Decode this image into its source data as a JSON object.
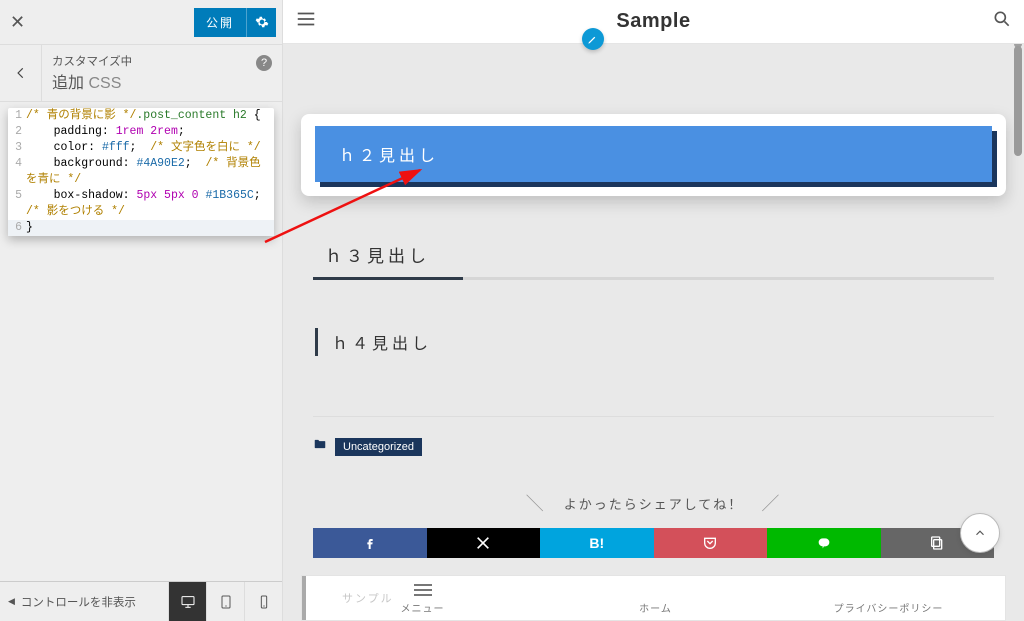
{
  "sidebar": {
    "publish_label": "公開",
    "crumb": "カスタマイズ中",
    "title_prefix": "追加",
    "title_thin": "CSS",
    "hide_controls": "コントロールを非表示"
  },
  "code": {
    "l1_comment": "/* 青の背景に影 */",
    "l1_sel": ".post_content h2",
    "l1_brace": " {",
    "l2_prop": "padding",
    "l2_val": "1rem 2rem",
    "l3_prop": "color",
    "l3_val": "#fff",
    "l3_comment": "/* 文字色を白に */",
    "l4_prop": "background",
    "l4_val": "#4A90E2",
    "l4_comment": "/* 背景色を青に */",
    "l5_prop": "box-shadow",
    "l5_val_nums": "5px 5px 0",
    "l5_val_hex": "#1B365C",
    "l5_comment": "/* 影をつける */",
    "l6": "}"
  },
  "preview": {
    "site_title": "Sample",
    "h2": "ｈ２見出し",
    "h3": "ｈ３見出し",
    "h4": "ｈ４見出し",
    "category": "Uncategorized",
    "share_text": "よかったらシェアしてね！",
    "hatena": "B!",
    "nav_menu": "メニュー",
    "nav_home": "ホーム",
    "nav_privacy": "プライバシーポリシー",
    "nav_faint": "サンプル"
  }
}
